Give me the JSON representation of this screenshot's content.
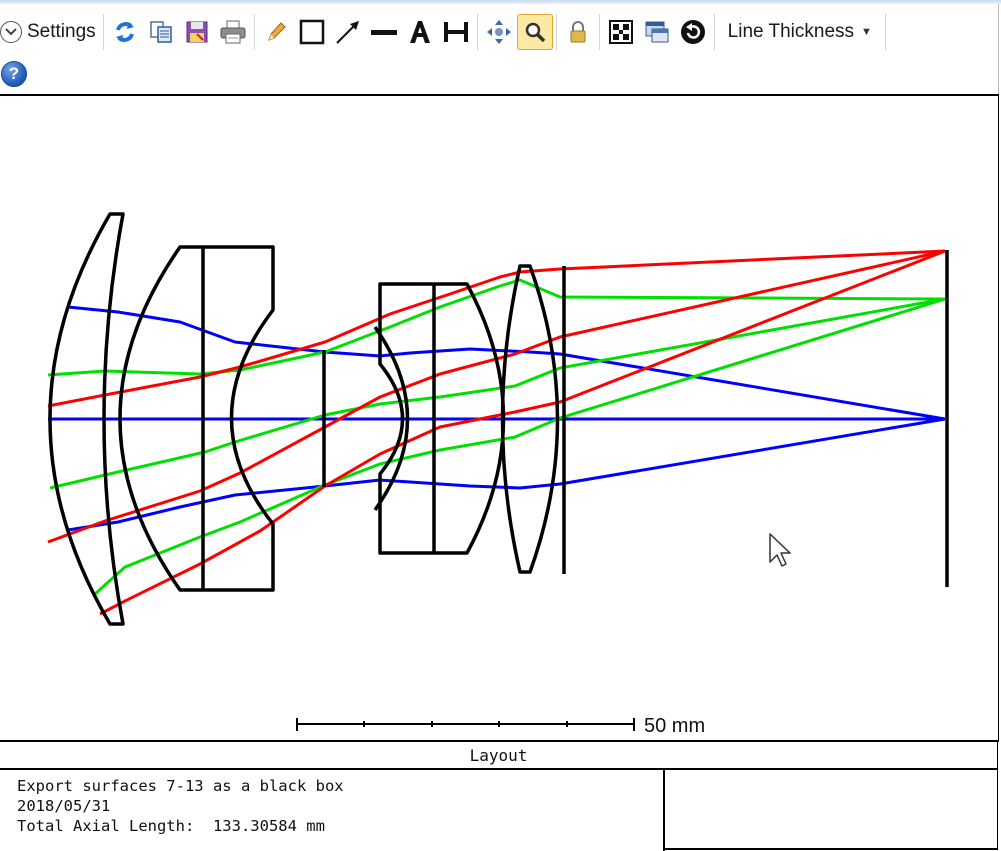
{
  "toolbar": {
    "settings_label": "Settings",
    "line_thickness_label": "Line Thickness",
    "buttons": [
      {
        "name": "refresh-icon",
        "interactable": true
      },
      {
        "name": "copy-icon",
        "interactable": true
      },
      {
        "name": "save-icon",
        "interactable": true
      },
      {
        "name": "print-icon",
        "interactable": true
      },
      {
        "name": "pencil-icon",
        "interactable": true
      },
      {
        "name": "rectangle-icon",
        "interactable": true
      },
      {
        "name": "arrow-icon",
        "interactable": true
      },
      {
        "name": "line-icon",
        "interactable": true
      },
      {
        "name": "text-icon",
        "interactable": true
      },
      {
        "name": "dimension-icon",
        "interactable": true
      },
      {
        "name": "pan-icon",
        "interactable": true
      },
      {
        "name": "zoom-icon",
        "interactable": true,
        "active": true
      },
      {
        "name": "lock-icon",
        "interactable": true
      },
      {
        "name": "grid-icon",
        "interactable": true
      },
      {
        "name": "window-icon",
        "interactable": true
      },
      {
        "name": "rotate-icon",
        "interactable": true
      }
    ],
    "help_label": "?"
  },
  "colors": {
    "ray_red": "#ff0000",
    "ray_green": "#00e000",
    "ray_blue": "#0000ff",
    "lens_outline": "#000000",
    "zoom_active_bg": "#fce9a6"
  },
  "layout": {
    "scale_bar_label": "50 mm",
    "caption": "Layout"
  },
  "info": {
    "line1": "Export surfaces 7-13 as a black box",
    "line2": "2018/05/31",
    "line3": "Total Axial Length:  133.30584 mm"
  }
}
